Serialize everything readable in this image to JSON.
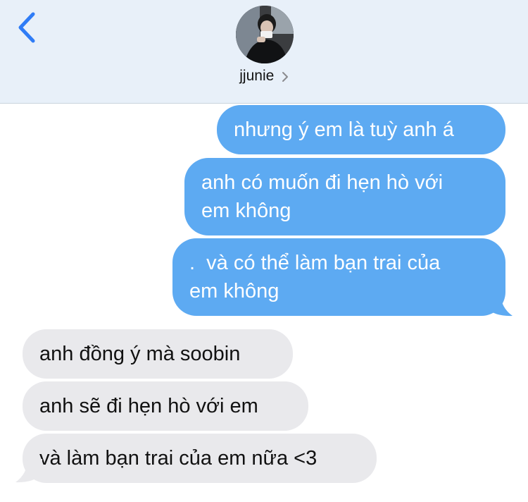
{
  "header": {
    "contact_name": "jjunie",
    "back_icon": "chevron-left-icon",
    "contact_chevron_icon": "chevron-right-icon",
    "accent_color": "#2f7cf6"
  },
  "messages": [
    {
      "direction": "sent",
      "text": "nhưng ý em là tuỳ anh á"
    },
    {
      "direction": "sent",
      "text": "anh có muốn đi hẹn hò với\nem không"
    },
    {
      "direction": "sent",
      "text": ".  và có thể làm bạn trai của\nem không"
    },
    {
      "direction": "received",
      "text": "anh đồng ý mà soobin"
    },
    {
      "direction": "received",
      "text": "anh sẽ đi hẹn hò với em"
    },
    {
      "direction": "received",
      "text": "và làm bạn trai của em nữa <3"
    }
  ],
  "colors": {
    "sent_bubble": "#5daaf2",
    "received_bubble": "#e9e9ec",
    "header_bg": "#e8f0f9"
  }
}
